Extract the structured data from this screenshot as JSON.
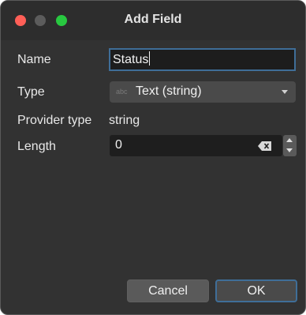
{
  "window": {
    "title": "Add Field"
  },
  "form": {
    "name_label": "Name",
    "name_value": "Status",
    "type_label": "Type",
    "type_icon_text": "abc",
    "type_value": "Text (string)",
    "provider_type_label": "Provider type",
    "provider_type_value": "string",
    "length_label": "Length",
    "length_value": "0"
  },
  "buttons": {
    "cancel_label": "Cancel",
    "ok_label": "OK"
  },
  "colors": {
    "window_bg": "#323232",
    "focus_accent": "#3f6e98",
    "close": "#ff5f57",
    "maximize": "#28c840"
  }
}
